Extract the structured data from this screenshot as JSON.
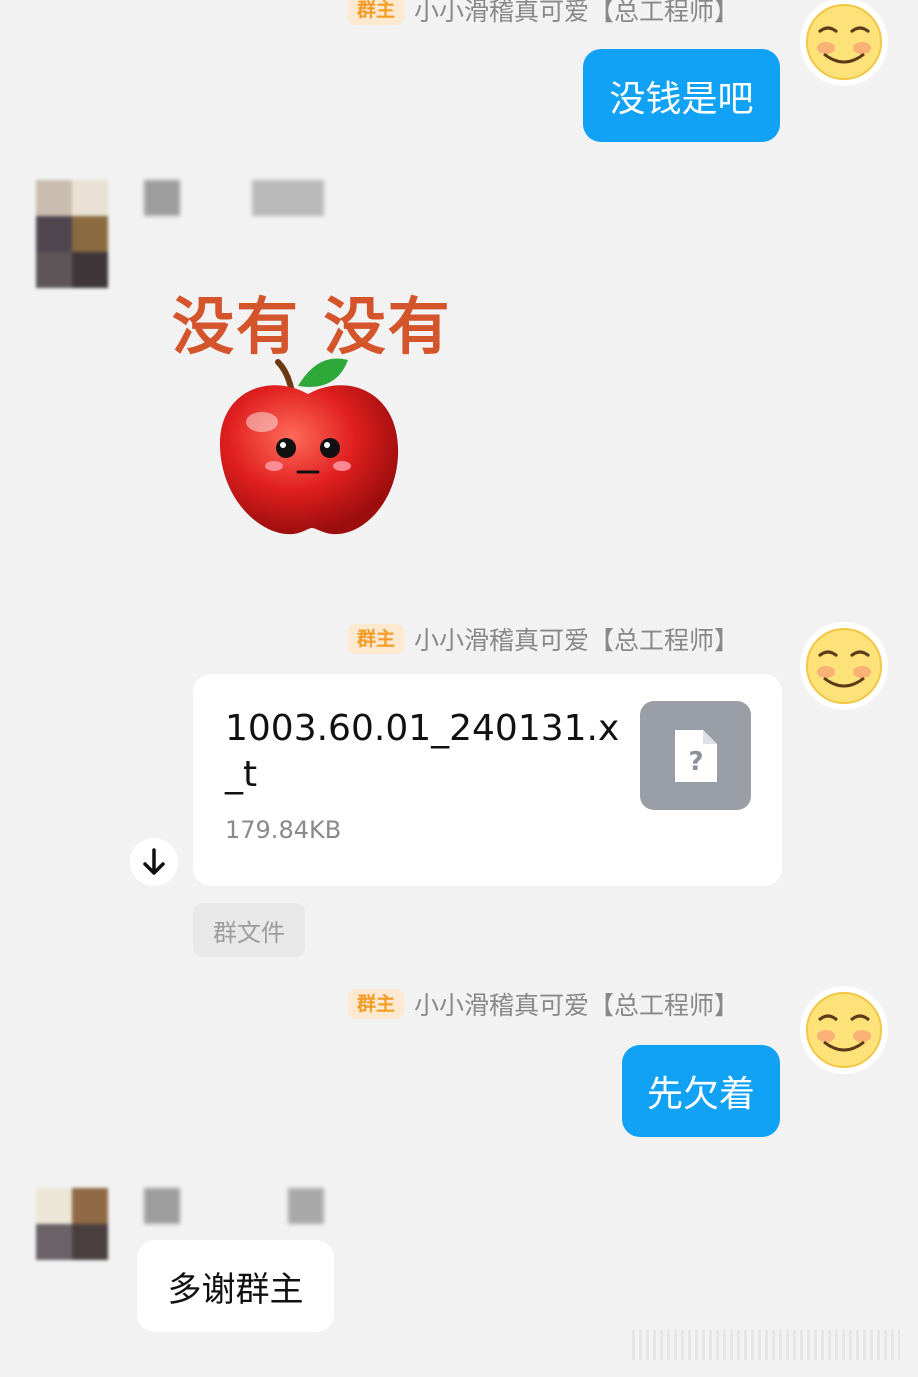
{
  "owner": {
    "badge": "群主",
    "name": "小小滑稽真可爱【总工程师】"
  },
  "messages": {
    "m1": {
      "text": "没钱是吧"
    },
    "sticker": {
      "caption": "没有 没有"
    },
    "file": {
      "filename_line1": "1003.60.01_240131.x",
      "filename_line2": "_t",
      "size": "179.84KB",
      "type_icon": "unknown-file-icon",
      "source_tag": "群文件"
    },
    "m3": {
      "text": "先欠着"
    },
    "m4": {
      "text": "多谢群主"
    }
  },
  "colors": {
    "bubble_blue": "#12a2f5",
    "badge_text": "#f49b25",
    "badge_bg": "#fde9cf",
    "background": "#f2f2f2"
  }
}
